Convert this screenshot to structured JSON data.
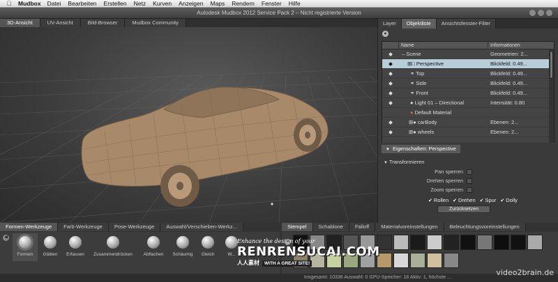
{
  "menubar": {
    "app": "Mudbox",
    "items": [
      "Datei",
      "Bearbeiten",
      "Erstellen",
      "Netz",
      "Kurven",
      "Anzeigen",
      "Maps",
      "Rendern",
      "Fenster",
      "Hilfe"
    ]
  },
  "window": {
    "title": "Autodesk Mudbox 2012 Service Pack 2 – Nicht registrierte Version"
  },
  "viewport_tabs": [
    "3D-Ansicht",
    "UV-Ansicht",
    "Bild-Browser",
    "Mudbox Community"
  ],
  "right_panel": {
    "tabs": [
      "Layer",
      "Objektliste",
      "Ansichtsfenster-Filter"
    ],
    "columns": {
      "name": "Name",
      "info": "Informationen"
    },
    "rows": [
      {
        "name": "Scene",
        "info": "Geometrien: 2..."
      },
      {
        "name": "Perspective",
        "info": "Blickfeld: 0.49..."
      },
      {
        "name": "Top",
        "info": "Blickfeld: 0.49..."
      },
      {
        "name": "Side",
        "info": "Blickfeld: 0.49..."
      },
      {
        "name": "Front",
        "info": "Blickfeld: 0.49..."
      },
      {
        "name": "Light 01 – Directional",
        "info": "Intensität: 0.80"
      },
      {
        "name": "Default Material",
        "info": ""
      },
      {
        "name": "carBody",
        "info": "Ebenen: 2..."
      },
      {
        "name": "wheels",
        "info": "Ebenen: 2..."
      }
    ],
    "props_tab": "Eigenschaften: Perspective",
    "section": "Transformieren",
    "prop_rows": [
      "Pan sperren",
      "Drehen sperren",
      "Zoom sperren"
    ],
    "checks": [
      "Rollen",
      "Drehen",
      "Spur",
      "Dolly"
    ],
    "reset_button": "Zurücksetzen"
  },
  "tool_tabs": [
    "Formen-Werkzeuge",
    "Farb-Werkzeuge",
    "Pose-Werkzeuge",
    "Auswahl/Verschieben-Werkz..."
  ],
  "tools": [
    "Formen",
    "Glätten",
    "Erfassen",
    "Zusammendrücken",
    "Abflachen",
    "Schäumig",
    "Gleich",
    "W..."
  ],
  "stamp_tabs": [
    "Stempel",
    "Schablone",
    "Falloff",
    "Materialvoreinstellungen",
    "Beleuchtungsvoreinstellungen"
  ],
  "status": {
    "text": "Insgesamt: 10336  Auswahl: 0 GPU-Speicher: 18  Aktiv: 1, höchste ..."
  },
  "watermarks": {
    "line1": "Enhance the design of your",
    "line2": "RENRENSUCAI.COM",
    "line3": "人人素材",
    "line3b": "WITH A GREAT SITE!",
    "corner": "video2brain.de"
  },
  "colors": {
    "selection_row": "#b7cdd8",
    "clay": "#a88a6a"
  }
}
